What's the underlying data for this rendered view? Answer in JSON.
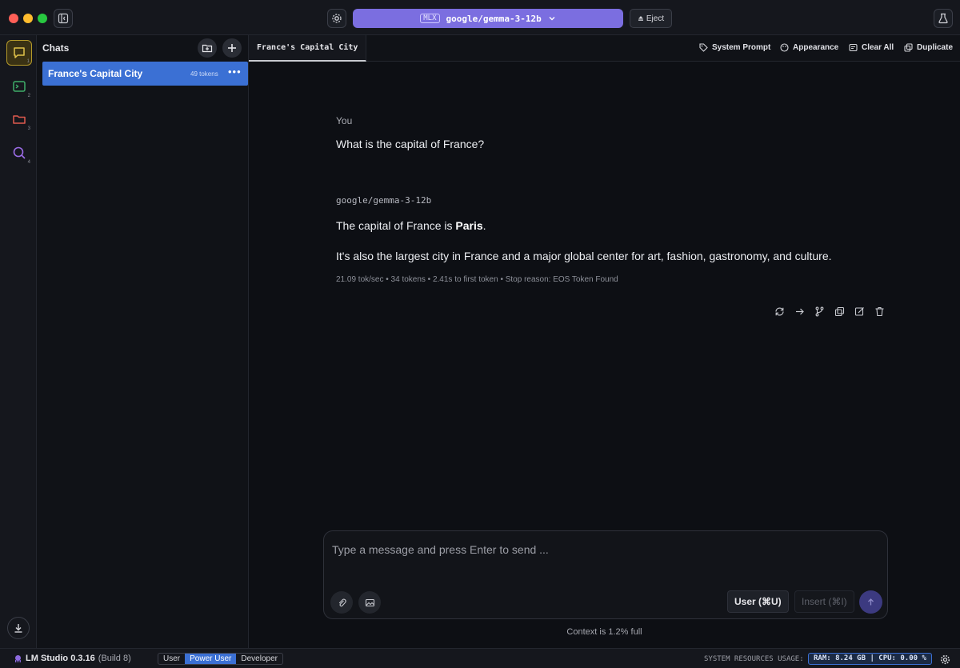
{
  "titlebar": {
    "model_tag": "MLX",
    "model_name": "google/gemma-3-12b",
    "eject_label": "Eject"
  },
  "sidebar": {
    "title": "Chats",
    "chats": [
      {
        "title": "France's Capital City",
        "tokens": "49 tokens"
      }
    ]
  },
  "main": {
    "tab_title": "France's Capital City",
    "toolbar": {
      "system_prompt": "System Prompt",
      "appearance": "Appearance",
      "clear_all": "Clear All",
      "duplicate": "Duplicate"
    },
    "messages": {
      "user_role": "You",
      "user_text": "What is the capital of France?",
      "assistant_model": "google/gemma-3-12b",
      "assistant_line1_prefix": "The capital of France is ",
      "assistant_line1_bold": "Paris",
      "assistant_line1_suffix": ".",
      "assistant_line2": "It's also the largest city in France and a major global center for art, fashion, gastronomy, and culture.",
      "stats": "21.09 tok/sec • 34 tokens • 2.41s to first token • Stop reason: EOS Token Found"
    },
    "composer": {
      "placeholder": "Type a message and press Enter to send ...",
      "user_label": "User (⌘U)",
      "insert_label": "Insert (⌘I)",
      "context": "Context is 1.2% full"
    }
  },
  "statusbar": {
    "app_name": "LM Studio 0.3.16",
    "build": "(Build 8)",
    "modes": [
      "User",
      "Power User",
      "Developer"
    ],
    "active_mode": "Power User",
    "resources_label": "SYSTEM RESOURCES USAGE:",
    "resources_value": "RAM: 8.24 GB | CPU: 0.00 %"
  },
  "colors": {
    "accent": "#7b6ee0",
    "selection": "#3b70d4",
    "background": "#0d0f14"
  }
}
